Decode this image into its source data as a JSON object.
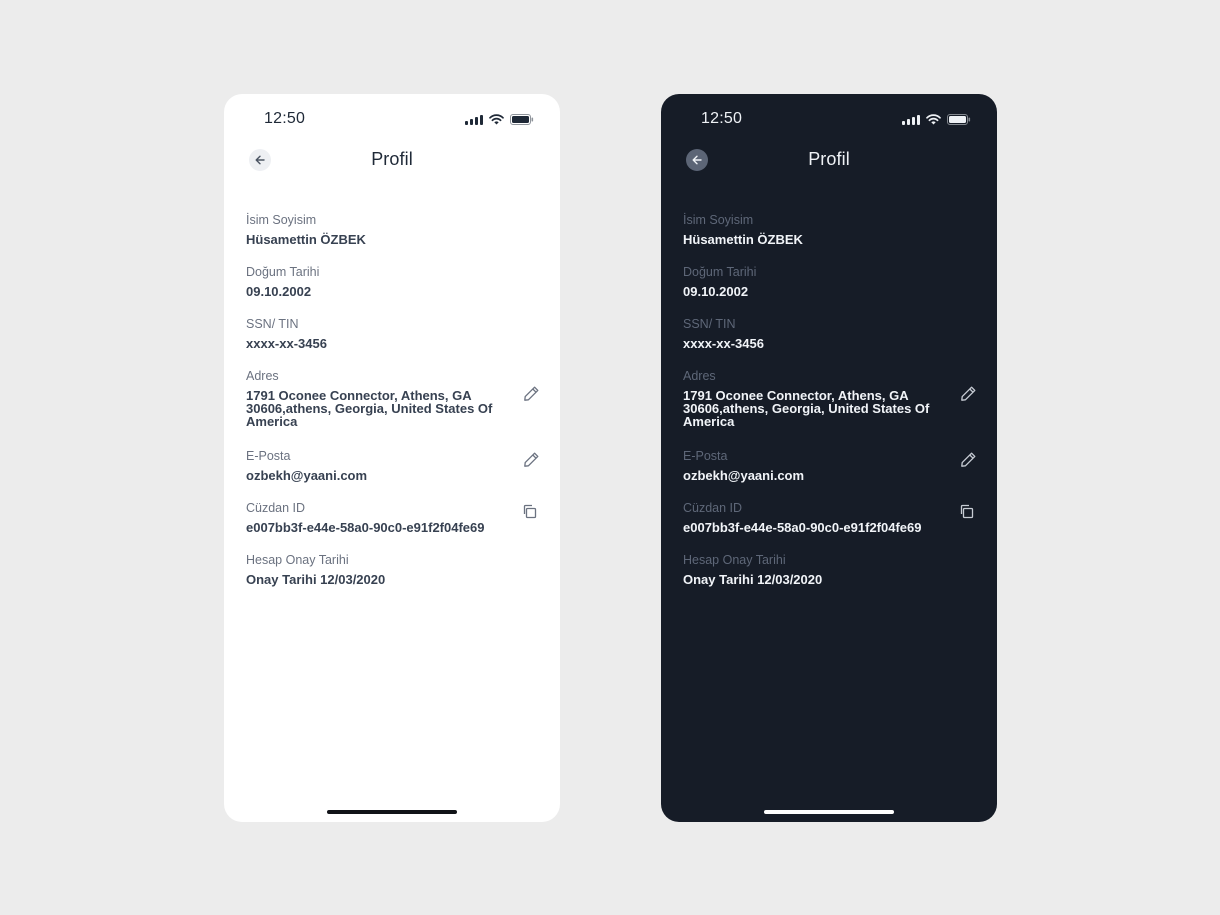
{
  "status": {
    "time": "12:50",
    "icons": [
      "signal-icon",
      "wifi-icon",
      "battery-icon"
    ]
  },
  "header": {
    "title": "Profil",
    "back_icon": "arrow-left-icon"
  },
  "fields": [
    {
      "label": "İsim Soyisim",
      "value": "Hüsamettin ÖZBEK"
    },
    {
      "label": "Doğum Tarihi",
      "value": "09.10.2002"
    },
    {
      "label": "SSN/ TIN",
      "value": "xxxx-xx-3456"
    },
    {
      "label": "Adres",
      "value": "1791 Oconee Connector, Athens, GA\n30606,athens, Georgia, United States Of\nAmerica",
      "action": "edit-icon"
    },
    {
      "label": "E-Posta",
      "value": "ozbekh@yaani.com",
      "action": "edit-icon"
    },
    {
      "label": "Cüzdan ID",
      "value": "e007bb3f-e44e-58a0-90c0-e91f2f04fe69",
      "action": "copy-icon"
    },
    {
      "label": "Hesap Onay Tarihi",
      "value": "Onay Tarihi 12/03/2020"
    }
  ],
  "themes": {
    "light": {
      "background": "#ffffff",
      "text": "#1f2937",
      "label": "#6b7280"
    },
    "dark": {
      "background": "#161c27",
      "text": "#f1f4f8",
      "label": "#5e6778"
    },
    "page_background": "#ececec"
  }
}
